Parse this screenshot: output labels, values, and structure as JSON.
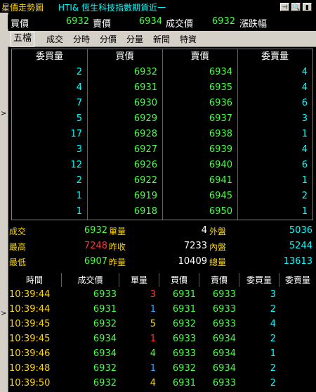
{
  "window": {
    "title": "星價走勢圖",
    "subtitle": "HTI&  恆生科技指數期貨近一",
    "buttons": [
      "⊣",
      "🔍",
      "▮"
    ]
  },
  "quote": {
    "buy_label": "買價",
    "buy_value": "6932",
    "sell_label": "賣價",
    "sell_value": "6934",
    "last_label": "成交價",
    "last_value": "6932",
    "change_label": "漲跌幅"
  },
  "tabs": [
    "五檔",
    "成交",
    "分時",
    "分價",
    "分量",
    "新聞",
    "特資"
  ],
  "book": {
    "headers": [
      "委買量",
      "買價",
      "賣價",
      "委賣量"
    ],
    "rows": [
      {
        "bid_qty": "2",
        "bid": "6932",
        "ask": "6934",
        "ask_qty": "4"
      },
      {
        "bid_qty": "4",
        "bid": "6931",
        "ask": "6935",
        "ask_qty": "4"
      },
      {
        "bid_qty": "7",
        "bid": "6930",
        "ask": "6936",
        "ask_qty": "6"
      },
      {
        "bid_qty": "5",
        "bid": "6929",
        "ask": "6937",
        "ask_qty": "3"
      },
      {
        "bid_qty": "17",
        "bid": "6928",
        "ask": "6938",
        "ask_qty": "1"
      },
      {
        "bid_qty": "3",
        "bid": "6927",
        "ask": "6939",
        "ask_qty": "4"
      },
      {
        "bid_qty": "12",
        "bid": "6926",
        "ask": "6940",
        "ask_qty": "6"
      },
      {
        "bid_qty": "2",
        "bid": "6922",
        "ask": "6941",
        "ask_qty": "1"
      },
      {
        "bid_qty": "1",
        "bid": "6919",
        "ask": "6945",
        "ask_qty": "2"
      },
      {
        "bid_qty": "1",
        "bid": "6918",
        "ask": "6950",
        "ask_qty": "1"
      }
    ]
  },
  "stats": {
    "rows": [
      {
        "l1": "成交",
        "v1": "6932",
        "l2": "單量",
        "v2": "4",
        "l3": "外盤",
        "v3": "5036"
      },
      {
        "l1": "最高",
        "v1": "7248",
        "l2": "昨收",
        "v2": "7233",
        "l3": "內盤",
        "v3": "5244"
      },
      {
        "l1": "最低",
        "v1": "6907",
        "l2": "昨量",
        "v2": "10409",
        "l3": "總量",
        "v3": "13613"
      }
    ]
  },
  "ticks": {
    "headers": [
      "時間",
      "成交價",
      "單量",
      "買價",
      "賣價",
      "委買量",
      "委賣量"
    ],
    "rows": [
      {
        "time": "10:39:44",
        "price": "6933",
        "qty": "3",
        "bid": "6931",
        "ask": "6933",
        "bq": "3",
        "aq": ""
      },
      {
        "time": "10:39:44",
        "price": "6931",
        "qty": "1",
        "bid": "6931",
        "ask": "6933",
        "bq": "2",
        "aq": ""
      },
      {
        "time": "10:39:45",
        "price": "6932",
        "qty": "5",
        "bid": "6932",
        "ask": "6933",
        "bq": "4",
        "aq": ""
      },
      {
        "time": "10:39:45",
        "price": "6934",
        "qty": "1",
        "bid": "6933",
        "ask": "6934",
        "bq": "2",
        "aq": ""
      },
      {
        "time": "10:39:46",
        "price": "6934",
        "qty": "4",
        "bid": "6933",
        "ask": "6934",
        "bq": "1",
        "aq": ""
      },
      {
        "time": "10:39:48",
        "price": "6932",
        "qty": "1",
        "bid": "6932",
        "ask": "6934",
        "bq": "2",
        "aq": ""
      },
      {
        "time": "10:39:50",
        "price": "6932",
        "qty": "4",
        "bid": "6931",
        "ask": "6933",
        "bq": "2",
        "aq": ""
      }
    ],
    "qty_colors": [
      "#ff3333",
      "#33aaff",
      "#ffd700",
      "#ff3333",
      "#44ff44",
      "#33aaff",
      "#ffd700"
    ]
  },
  "colors": {
    "up": "#44ff44",
    "down": "#ff3333",
    "neutral": "#ffd700",
    "qty": "#00ffff",
    "label": "#ffd700"
  }
}
